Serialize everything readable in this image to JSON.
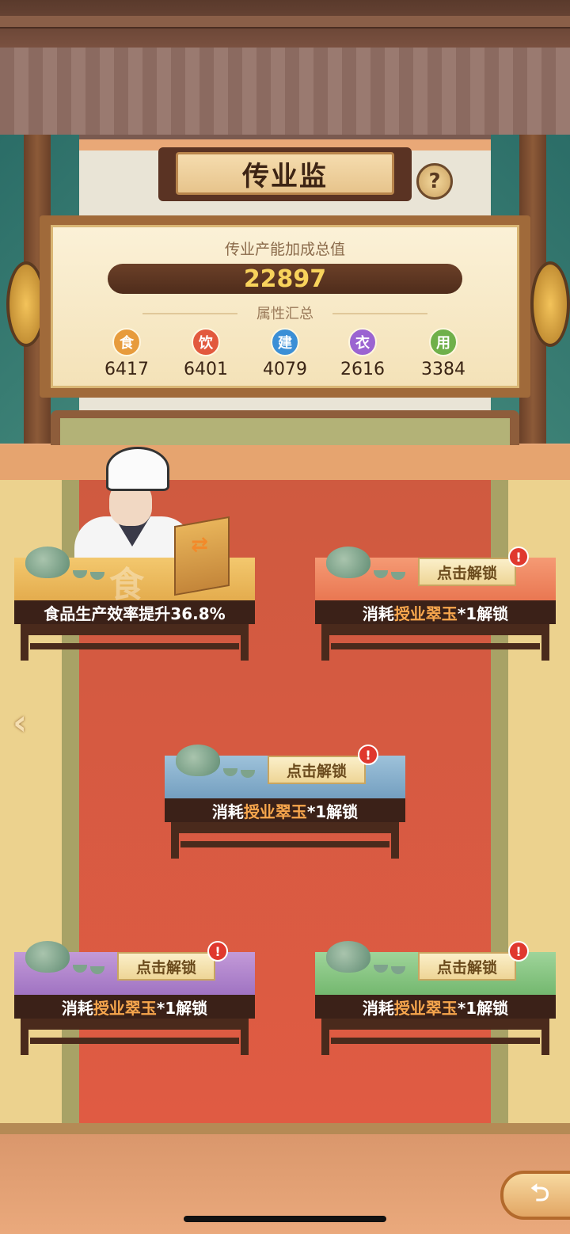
{
  "header": {
    "title": "传业监",
    "help_icon": "?"
  },
  "stats": {
    "label": "传业产能加成总值",
    "total": "22897",
    "attributes_title": "属性汇总",
    "attributes": [
      {
        "icon": "食",
        "value": "6417",
        "color": "#e79b3c"
      },
      {
        "icon": "饮",
        "value": "6401",
        "color": "#e2593e"
      },
      {
        "icon": "建",
        "value": "4079",
        "color": "#3b8fd6"
      },
      {
        "icon": "衣",
        "value": "2616",
        "color": "#9b64d1"
      },
      {
        "icon": "用",
        "value": "3384",
        "color": "#6fb04a"
      }
    ]
  },
  "tables": [
    {
      "cloth": "#e9b95a",
      "desc": "食品生产效率提升36.8%",
      "locked": false,
      "watermark": "食"
    },
    {
      "cloth": "#ef7d5a",
      "prefix": "消耗",
      "item": "授业翠玉",
      "suffix": "*1解锁",
      "unlock": "点击解锁",
      "alert": "!",
      "locked": true
    },
    {
      "cloth": "#7ca7c8",
      "prefix": "消耗",
      "item": "授业翠玉",
      "suffix": "*1解锁",
      "unlock": "点击解锁",
      "alert": "!",
      "locked": true
    },
    {
      "cloth": "#a877c4",
      "prefix": "消耗",
      "item": "授业翠玉",
      "suffix": "*1解锁",
      "unlock": "点击解锁",
      "alert": "!",
      "locked": true
    },
    {
      "cloth": "#7bc07b",
      "prefix": "消耗",
      "item": "授业翠玉",
      "suffix": "*1解锁",
      "unlock": "点击解锁",
      "alert": "!",
      "locked": true
    }
  ],
  "nav": {
    "left_arrow": "‹",
    "back_icon": "⮌",
    "swap_icon": "⇄"
  }
}
